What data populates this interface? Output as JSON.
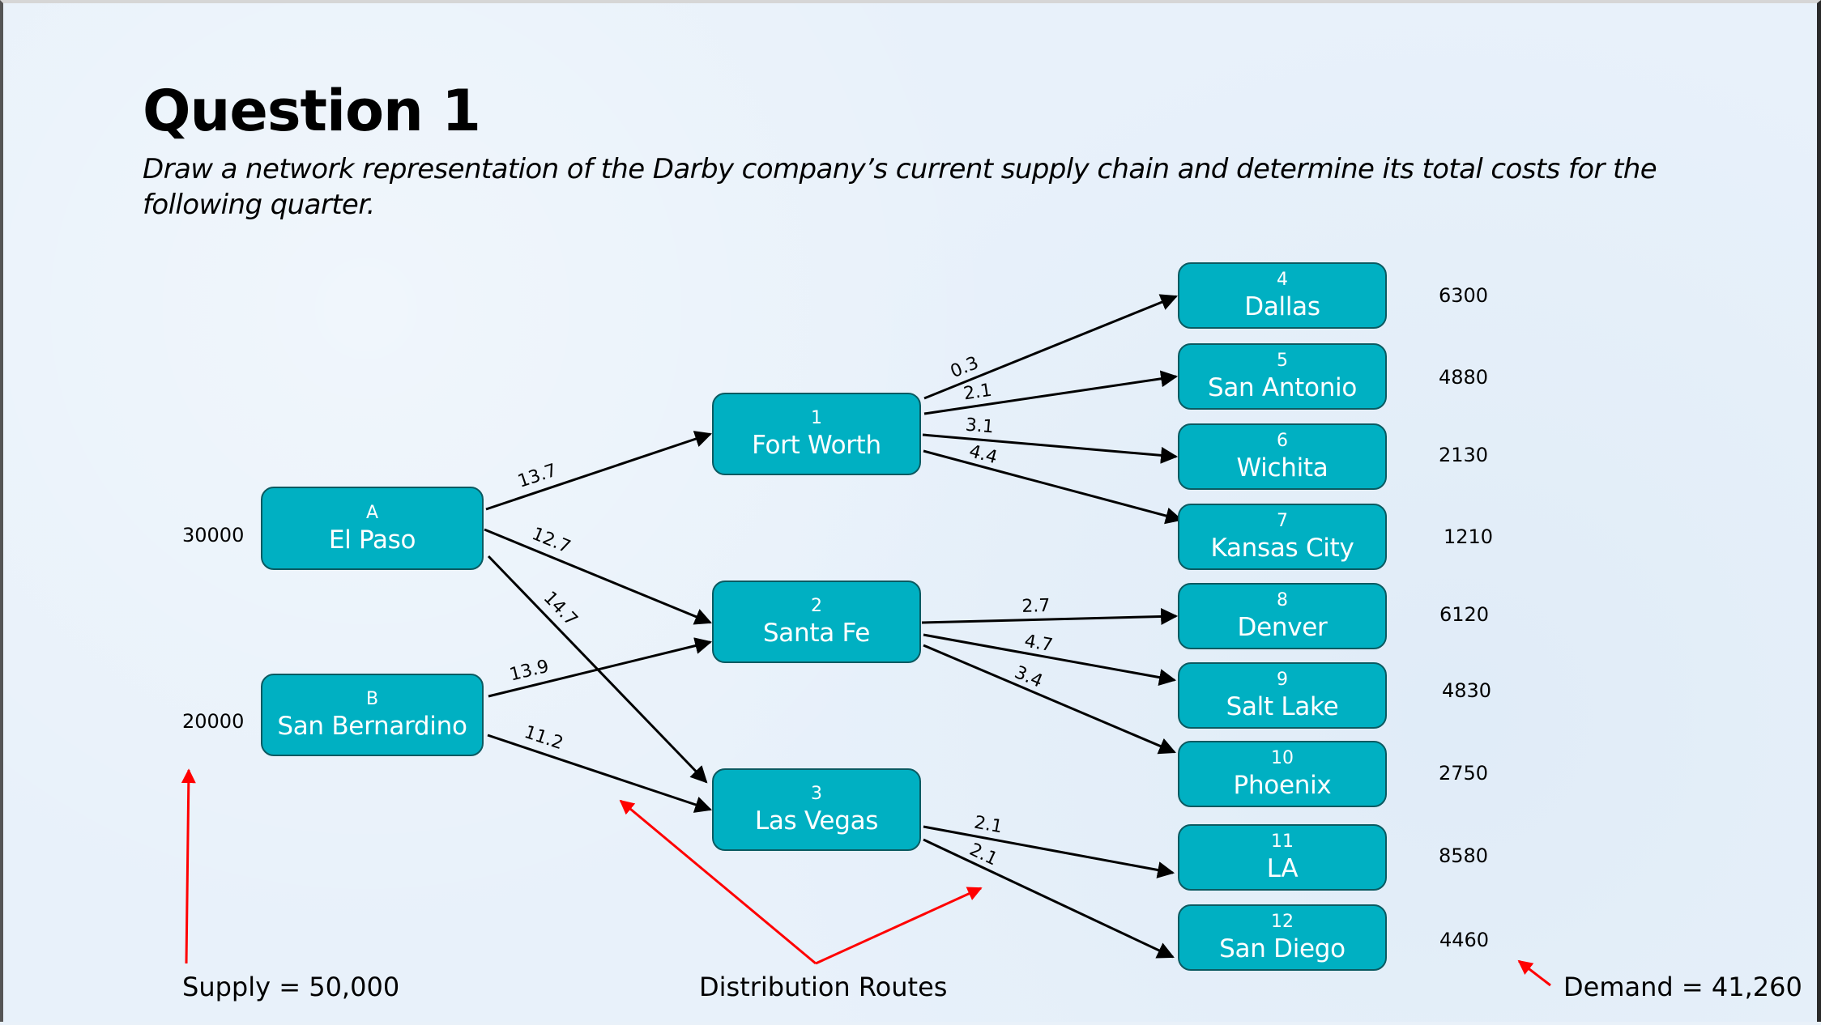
{
  "slide": {
    "title": "Question 1",
    "subtitle_line1": "Draw a network representation of the Darby company’s current supply chain and determine its total costs for the",
    "subtitle_line2": "following quarter."
  },
  "colors": {
    "node_fill": "#00b0c2",
    "node_border": "#0b5a61",
    "edge": "#000000",
    "annotation_arrow": "#ff0000"
  },
  "supply_nodes": [
    {
      "id": "A",
      "name": "El Paso",
      "supply": "30000"
    },
    {
      "id": "B",
      "name": "San Bernardino",
      "supply": "20000"
    }
  ],
  "transshipment_nodes": [
    {
      "id": "1",
      "name": "Fort Worth"
    },
    {
      "id": "2",
      "name": "Santa Fe"
    },
    {
      "id": "3",
      "name": "Las Vegas"
    }
  ],
  "demand_nodes": [
    {
      "id": "4",
      "name": "Dallas",
      "demand": "6300"
    },
    {
      "id": "5",
      "name": "San Antonio",
      "demand": "4880"
    },
    {
      "id": "6",
      "name": "Wichita",
      "demand": "2130"
    },
    {
      "id": "7",
      "name": "Kansas City",
      "demand": "1210"
    },
    {
      "id": "8",
      "name": "Denver",
      "demand": "6120"
    },
    {
      "id": "9",
      "name": "Salt Lake",
      "demand": "4830"
    },
    {
      "id": "10",
      "name": "Phoenix",
      "demand": "2750"
    },
    {
      "id": "11",
      "name": "LA",
      "demand": "8580"
    },
    {
      "id": "12",
      "name": "San Diego",
      "demand": "4460"
    }
  ],
  "edges": [
    {
      "from": "A",
      "to": "1",
      "cost": "13.7"
    },
    {
      "from": "A",
      "to": "2",
      "cost": "12.7"
    },
    {
      "from": "A",
      "to": "3",
      "cost": "14.7"
    },
    {
      "from": "B",
      "to": "2",
      "cost": "13.9"
    },
    {
      "from": "B",
      "to": "3",
      "cost": "11.2"
    },
    {
      "from": "1",
      "to": "4",
      "cost": "0.3"
    },
    {
      "from": "1",
      "to": "5",
      "cost": "2.1"
    },
    {
      "from": "1",
      "to": "6",
      "cost": "3.1"
    },
    {
      "from": "1",
      "to": "7",
      "cost": "4.4"
    },
    {
      "from": "2",
      "to": "8",
      "cost": "2.7"
    },
    {
      "from": "2",
      "to": "9",
      "cost": "4.7"
    },
    {
      "from": "2",
      "to": "10",
      "cost": "3.4"
    },
    {
      "from": "3",
      "to": "11",
      "cost": "2.1"
    },
    {
      "from": "3",
      "to": "12",
      "cost": "2.1"
    }
  ],
  "annotations": {
    "supply_total": "Supply = 50,000",
    "distribution_routes": "Distribution Routes",
    "demand_total": "Demand = 41,260"
  }
}
